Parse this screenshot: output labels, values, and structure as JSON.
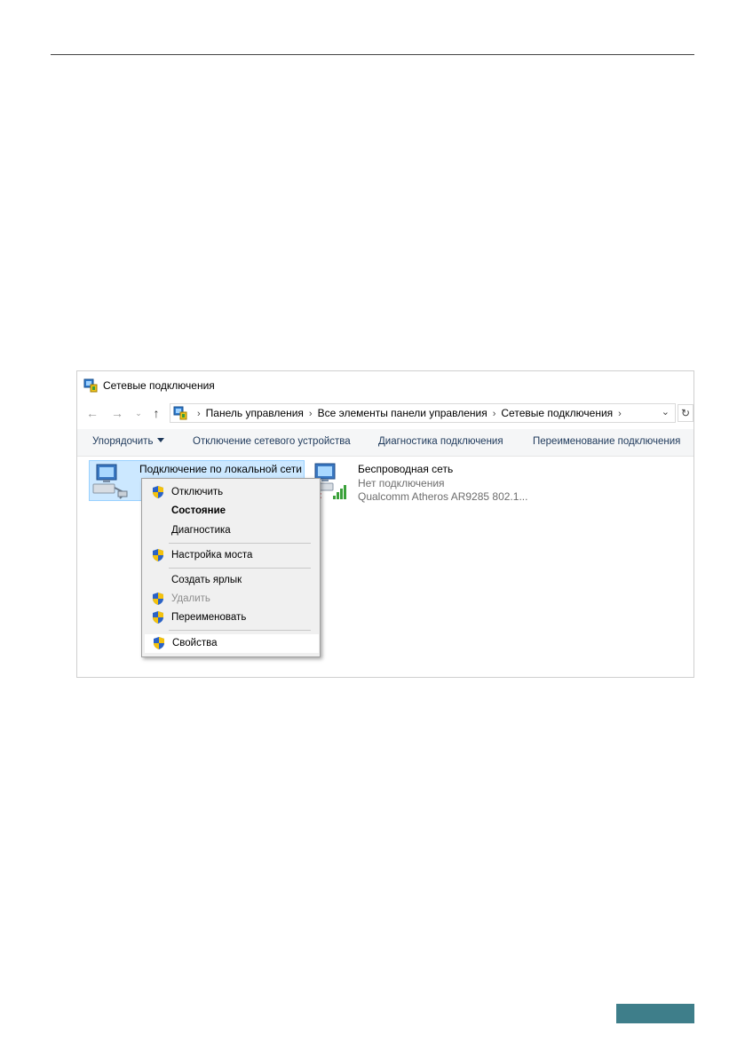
{
  "window": {
    "title": "Сетевые подключения"
  },
  "address_bar": {
    "crumbs": [
      "Панель управления",
      "Все элементы панели управления",
      "Сетевые подключения"
    ]
  },
  "toolbar": {
    "organize": "Упорядочить",
    "disable_device": "Отключение сетевого устройства",
    "diagnose": "Диагностика подключения",
    "rename": "Переименование подключения"
  },
  "connections": [
    {
      "name": "Подключение по локальной сети",
      "status": "",
      "adapter": ""
    },
    {
      "name": "Беспроводная сеть",
      "status": "Нет подключения",
      "adapter": "Qualcomm Atheros AR9285 802.1..."
    }
  ],
  "context_menu": {
    "items": [
      {
        "label": "Отключить",
        "shield": true,
        "state": "normal"
      },
      {
        "label": "Состояние",
        "shield": false,
        "state": "bold"
      },
      {
        "label": "Диагностика",
        "shield": false,
        "state": "normal"
      },
      {
        "label": "Настройка моста",
        "shield": true,
        "state": "normal"
      },
      {
        "label": "Создать ярлык",
        "shield": false,
        "state": "normal"
      },
      {
        "label": "Удалить",
        "shield": true,
        "state": "disabled"
      },
      {
        "label": "Переименовать",
        "shield": true,
        "state": "normal"
      },
      {
        "label": "Свойства",
        "shield": true,
        "state": "hover"
      }
    ]
  },
  "colors": {
    "accent": "#3e7e8a",
    "selection": "#cce8ff",
    "toolbar_text": "#1e395b"
  }
}
